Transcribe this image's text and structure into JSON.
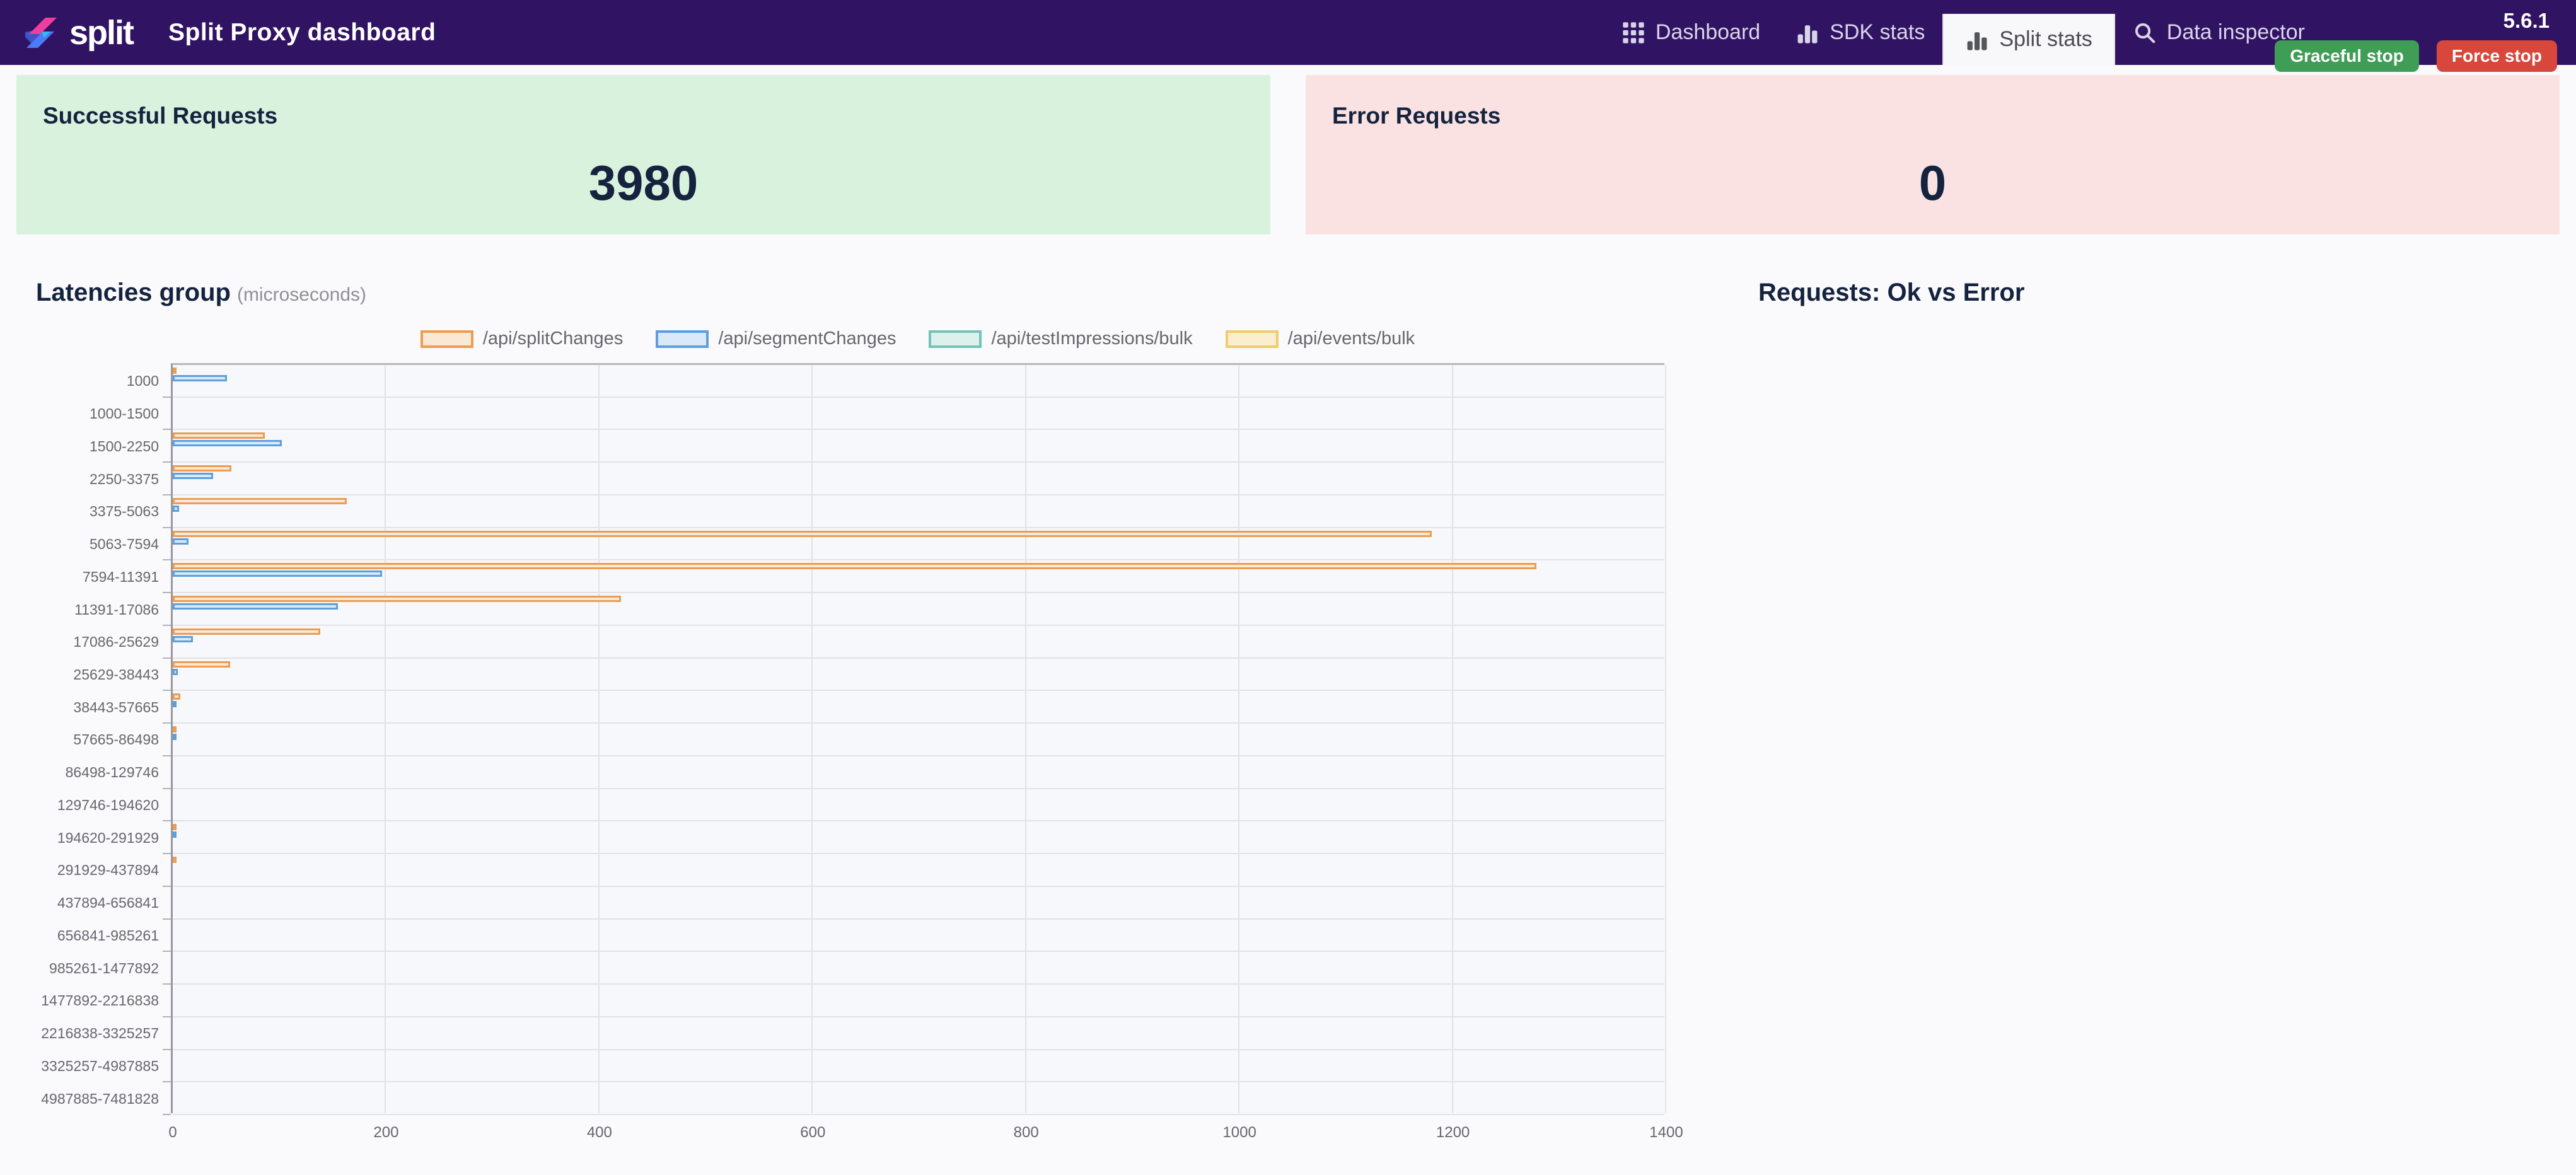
{
  "header": {
    "logo_text": "split",
    "title": "Split Proxy dashboard",
    "nav": [
      {
        "label": "Dashboard",
        "icon": "grid-icon",
        "active": false
      },
      {
        "label": "SDK stats",
        "icon": "bar-chart-icon",
        "active": false
      },
      {
        "label": "Split stats",
        "icon": "bar-chart-icon",
        "active": true
      },
      {
        "label": "Data inspector",
        "icon": "search-icon",
        "active": false
      }
    ],
    "version": "5.6.1",
    "buttons": [
      {
        "label": "Graceful stop",
        "color": "#3f9d55"
      },
      {
        "label": "Force stop",
        "color": "#d8473b"
      }
    ]
  },
  "cards": [
    {
      "title": "Successful Requests",
      "value": "3980",
      "bg": "#d9f2de"
    },
    {
      "title": "Error Requests",
      "value": "0",
      "bg": "#f9e2e1"
    }
  ],
  "chart_data": [
    {
      "type": "bar",
      "orientation": "horizontal",
      "title": "Latencies group",
      "subtitle": "(microseconds)",
      "xlabel": "",
      "ylabel": "",
      "xlim": [
        0,
        1400
      ],
      "xticks": [
        0,
        200,
        400,
        600,
        800,
        1000,
        1200,
        1400
      ],
      "grid": true,
      "legend_position": "top",
      "categories": [
        "1000",
        "1000-1500",
        "1500-2250",
        "2250-3375",
        "3375-5063",
        "5063-7594",
        "7594-11391",
        "11391-17086",
        "17086-25629",
        "25629-38443",
        "38443-57665",
        "57665-86498",
        "86498-129746",
        "129746-194620",
        "194620-291929",
        "291929-437894",
        "437894-656841",
        "656841-985261",
        "985261-1477892",
        "1477892-2216838",
        "2216838-3325257",
        "3325257-4987885",
        "4987885-7481828"
      ],
      "series": [
        {
          "name": "/api/splitChanges",
          "border": "#eb9d52",
          "fill": "#fae8d5",
          "values": [
            2,
            0,
            86,
            55,
            163,
            1180,
            1278,
            420,
            138,
            54,
            7,
            3,
            0,
            0,
            2,
            1,
            0,
            0,
            0,
            0,
            0,
            0,
            0
          ]
        },
        {
          "name": "/api/segmentChanges",
          "border": "#5d9fdd",
          "fill": "#d9e9f8",
          "values": [
            51,
            0,
            102,
            38,
            6,
            15,
            196,
            155,
            19,
            5,
            1,
            1,
            0,
            0,
            1,
            0,
            0,
            0,
            0,
            0,
            0,
            0,
            0
          ]
        },
        {
          "name": "/api/testImpressions/bulk",
          "border": "#72c3b8",
          "fill": "#ddf0ec",
          "values": [
            0,
            0,
            0,
            0,
            0,
            0,
            0,
            0,
            0,
            0,
            0,
            0,
            0,
            0,
            0,
            0,
            0,
            0,
            0,
            0,
            0,
            0,
            0
          ]
        },
        {
          "name": "/api/events/bulk",
          "border": "#f0cc6d",
          "fill": "#faeecf",
          "values": [
            0,
            0,
            0,
            0,
            0,
            0,
            0,
            0,
            0,
            0,
            0,
            0,
            0,
            0,
            0,
            0,
            0,
            0,
            0,
            0,
            0,
            0,
            0
          ]
        }
      ]
    },
    {
      "type": "pie",
      "title": "Requests: Ok vs Error",
      "labels": [],
      "values": []
    }
  ]
}
